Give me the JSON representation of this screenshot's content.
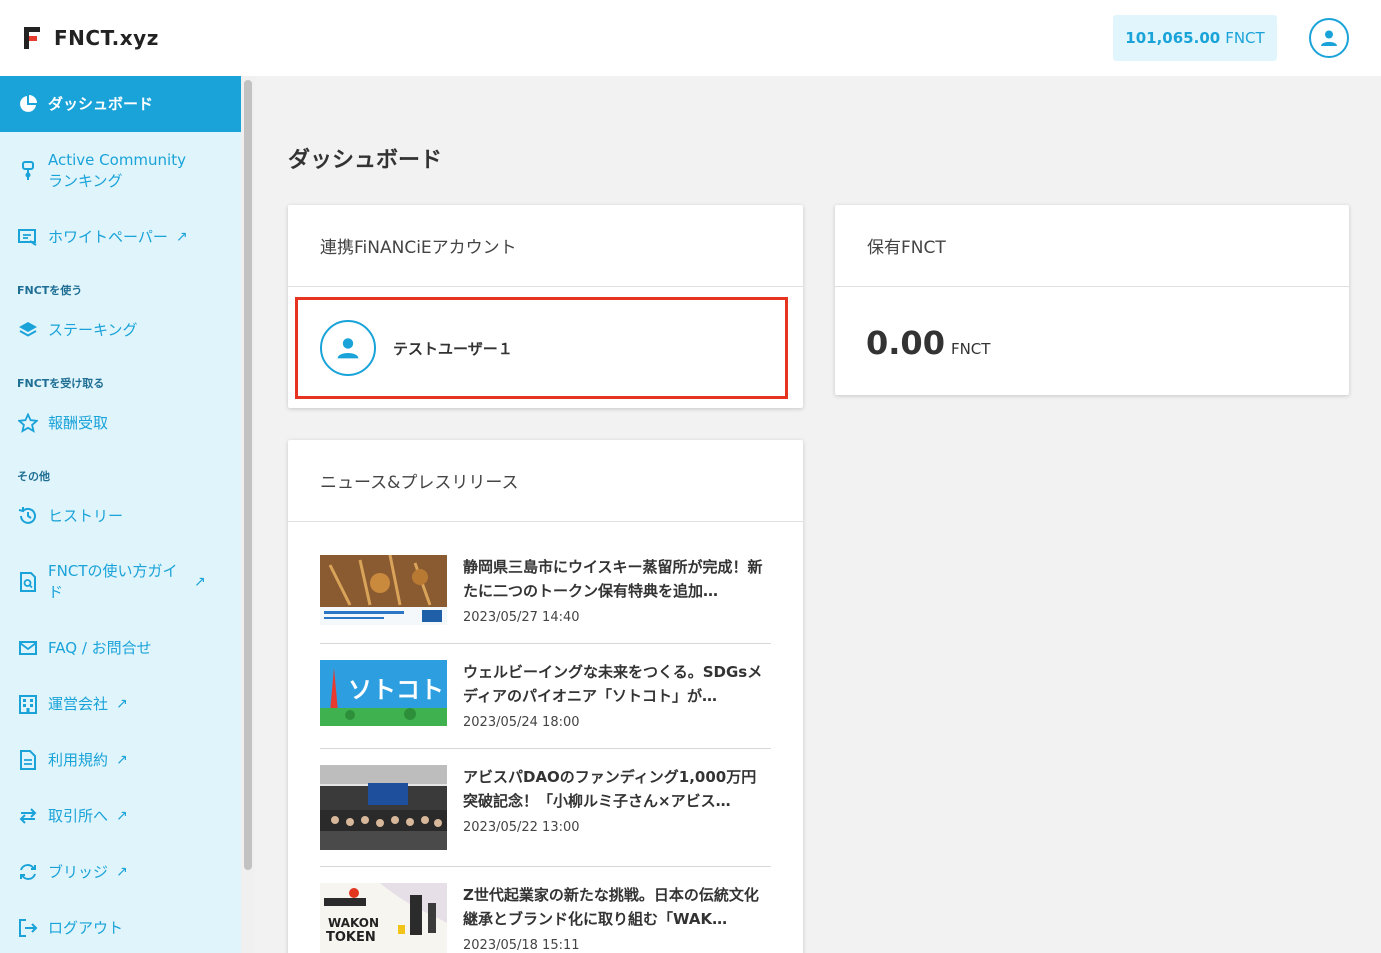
{
  "header": {
    "logo_text": "FNCT.xyz",
    "balance_amount": "101,065.00",
    "balance_unit": "FNCT",
    "accent_color": "#1aa3d9"
  },
  "sidebar": {
    "items": [
      {
        "label": "ダッシュボード",
        "icon": "pie-chart-icon",
        "active": true
      },
      {
        "label": "Active Community ランキング",
        "label_line1": "Active Community",
        "label_line2": "ランキング",
        "icon": "medal-icon"
      },
      {
        "label": "ホワイトペーパー",
        "icon": "whitepaper-icon",
        "external": true
      },
      {
        "label": "ステーキング",
        "icon": "layers-icon"
      },
      {
        "label": "報酬受取",
        "icon": "star-icon"
      },
      {
        "label": "ヒストリー",
        "icon": "history-icon"
      },
      {
        "label": "FNCTの使い方ガイド",
        "label_line1": "FNCTの使い方ガイ",
        "label_line2": "ド",
        "icon": "guide-icon",
        "external": true
      },
      {
        "label": "FAQ / お問合せ",
        "icon": "mail-icon"
      },
      {
        "label": "運営会社",
        "icon": "building-icon",
        "external": true
      },
      {
        "label": "利用規約",
        "icon": "document-icon",
        "external": true
      },
      {
        "label": "取引所へ",
        "icon": "exchange-icon",
        "external": true
      },
      {
        "label": "ブリッジ",
        "icon": "bridge-icon",
        "external": true
      },
      {
        "label": "ログアウト",
        "icon": "logout-icon"
      }
    ],
    "sections": [
      "FNCTを使う",
      "FNCTを受け取る",
      "その他"
    ],
    "external_mark": "↗"
  },
  "main": {
    "title": "ダッシュボード",
    "account_card": {
      "title": "連携FiNANCiEアカウント",
      "user_name": "テストユーザー１"
    },
    "fnct_card": {
      "title": "保有FNCT",
      "value": "0.00",
      "unit": "FNCT"
    },
    "news_card": {
      "title": "ニュース&プレスリリース",
      "items": [
        {
          "title": "静岡県三島市にウイスキー蒸留所が完成！新たに二つのトークン保有特典を追加…",
          "date": "2023/05/27 14:40",
          "thumb": "whisky-distillery-thumb"
        },
        {
          "title": "ウェルビーイングな未来をつくる。SDGsメディアのパイオニア「ソトコト」が…",
          "date": "2023/05/24 18:00",
          "thumb": "sotokoto-thumb",
          "thumb_text": "ソトコト"
        },
        {
          "title": "アビスパDAOのファンディング1,000万円突破記念！「小柳ルミ子さん×アビス…",
          "date": "2023/05/22 13:00",
          "thumb": "event-group-photo-thumb"
        },
        {
          "title": "Z世代起業家の新たな挑戦。日本の伝統文化継承とブランド化に取り組む「WAK…",
          "date": "2023/05/18 15:11",
          "thumb": "wakon-token-thumb",
          "thumb_text_line1": "WAKON",
          "thumb_text_line2": "TOKEN"
        }
      ]
    }
  }
}
